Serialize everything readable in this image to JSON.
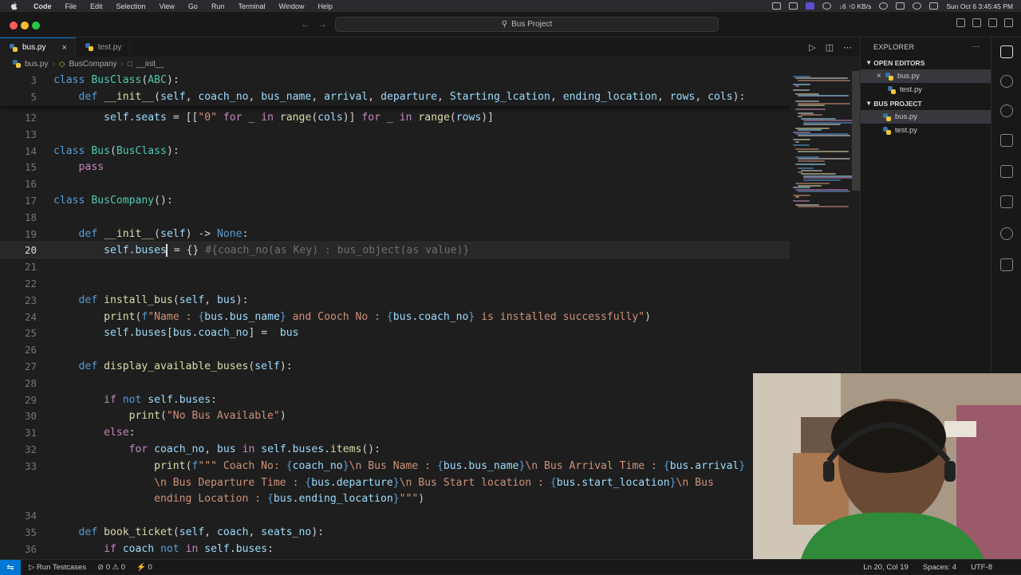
{
  "menubar": {
    "app": "Code",
    "items": [
      "File",
      "Edit",
      "Selection",
      "View",
      "Go",
      "Run",
      "Terminal",
      "Window",
      "Help"
    ],
    "net_speed": "↓6 ↑0 KB/s",
    "datetime": "Sun Oct 6  3:45:45 PM"
  },
  "titlebar": {
    "project": "Bus Project"
  },
  "tabs": [
    {
      "label": "bus.py",
      "active": true
    },
    {
      "label": "test.py",
      "active": false
    }
  ],
  "breadcrumb": {
    "file": "bus.py",
    "cls": "BusCompany",
    "method": "__init__"
  },
  "editor": {
    "cursor_line": "20",
    "lines": [
      {
        "n": "3",
        "html": "<span class=\"k\">class</span> <span class=\"c\">BusClass</span><span class=\"b\">(</span><span class=\"c\">ABC</span><span class=\"b\">):</span>"
      },
      {
        "n": "5",
        "html": "    <span class=\"k\">def</span> <span class=\"f\">__init__</span><span class=\"b\">(</span><span class=\"p\">self</span>, <span class=\"p\">coach_no</span>, <span class=\"p\">bus_name</span>, <span class=\"p\">arrival</span>, <span class=\"p\">departure</span>, <span class=\"p\">Starting_lcation</span>, <span class=\"p\">ending_location</span>, <span class=\"p\">rows</span>, <span class=\"p\">cols</span><span class=\"b\">):</span>"
      },
      {
        "n": "12",
        "html": "        <span class=\"p\">self</span>.<span class=\"v\">seats</span> = [[<span class=\"s\">\"0\"</span> <span class=\"kw\">for</span> <span class=\"v\">_</span> <span class=\"kw\">in</span> <span class=\"f\">range</span>(<span class=\"v\">cols</span>)] <span class=\"kw\">for</span> <span class=\"v\">_</span> <span class=\"kw\">in</span> <span class=\"f\">range</span>(<span class=\"v\">rows</span>)]"
      },
      {
        "n": "13",
        "html": ""
      },
      {
        "n": "14",
        "html": "<span class=\"k\">class</span> <span class=\"c\">Bus</span>(<span class=\"c\">BusClass</span>):"
      },
      {
        "n": "15",
        "html": "    <span class=\"kw\">pass</span>"
      },
      {
        "n": "16",
        "html": ""
      },
      {
        "n": "17",
        "html": "<span class=\"k\">class</span> <span class=\"c\">BusCompany</span>():"
      },
      {
        "n": "18",
        "html": ""
      },
      {
        "n": "19",
        "html": "    <span class=\"k\">def</span> <span class=\"f\">__init__</span>(<span class=\"p\">self</span>) -> <span class=\"k\">None</span>:"
      },
      {
        "n": "20",
        "html": "        <span class=\"p\">self</span>.<span class=\"v\">buses</span><span class=\"cursor\"></span> = {} <span class=\"ghost\">#{coach_no(as Key) : bus_object(as value)}</span>"
      },
      {
        "n": "21",
        "html": ""
      },
      {
        "n": "22",
        "html": ""
      },
      {
        "n": "23",
        "html": "    <span class=\"k\">def</span> <span class=\"f\">install_bus</span>(<span class=\"p\">self</span>, <span class=\"p\">bus</span>):"
      },
      {
        "n": "24",
        "html": "        <span class=\"f\">print</span>(<span class=\"k\">f</span><span class=\"s\">\"Name : </span><span class=\"k\">{</span><span class=\"v\">bus</span>.<span class=\"v\">bus_name</span><span class=\"k\">}</span><span class=\"s\"> and Cooch No : </span><span class=\"k\">{</span><span class=\"v\">bus</span>.<span class=\"v\">coach_no</span><span class=\"k\">}</span><span class=\"s\"> is installed successfully\"</span>)"
      },
      {
        "n": "25",
        "html": "        <span class=\"p\">self</span>.<span class=\"v\">buses</span>[<span class=\"v\">bus</span>.<span class=\"v\">coach_no</span>] =  <span class=\"v\">bus</span>"
      },
      {
        "n": "26",
        "html": ""
      },
      {
        "n": "27",
        "html": "    <span class=\"k\">def</span> <span class=\"f\">display_available_buses</span>(<span class=\"p\">self</span>):"
      },
      {
        "n": "28",
        "html": ""
      },
      {
        "n": "29",
        "html": "        <span class=\"kw\">if</span> <span class=\"k\">not</span> <span class=\"p\">self</span>.<span class=\"v\">buses</span>:"
      },
      {
        "n": "30",
        "html": "            <span class=\"f\">print</span>(<span class=\"s\">\"No Bus Available\"</span>)"
      },
      {
        "n": "31",
        "html": "        <span class=\"kw\">else</span>:"
      },
      {
        "n": "32",
        "html": "            <span class=\"kw\">for</span> <span class=\"v\">coach_no</span>, <span class=\"v\">bus</span> <span class=\"kw\">in</span> <span class=\"p\">self</span>.<span class=\"v\">buses</span>.<span class=\"f\">items</span>():"
      },
      {
        "n": "33",
        "html": "                <span class=\"f\">print</span>(<span class=\"k\">f</span><span class=\"s\">\"\"\" Coach No: </span><span class=\"k\">{</span><span class=\"v\">coach_no</span><span class=\"k\">}</span><span class=\"s\">\\n Bus Name : </span><span class=\"k\">{</span><span class=\"v\">bus</span>.<span class=\"v\">bus_name</span><span class=\"k\">}</span><span class=\"s\">\\n Bus Arrival Time : </span><span class=\"k\">{</span><span class=\"v\">bus</span>.<span class=\"v\">arrival</span><span class=\"k\">}</span>"
      },
      {
        "n": "",
        "html": "                <span class=\"s\">\\n Bus Departure Time : </span><span class=\"k\">{</span><span class=\"v\">bus</span>.<span class=\"v\">departure</span><span class=\"k\">}</span><span class=\"s\">\\n Bus Start location : </span><span class=\"k\">{</span><span class=\"v\">bus</span>.<span class=\"v\">start_location</span><span class=\"k\">}</span><span class=\"s\">\\n Bus</span>"
      },
      {
        "n": "",
        "html": "                <span class=\"s\">ending Location : </span><span class=\"k\">{</span><span class=\"v\">bus</span>.<span class=\"v\">ending_location</span><span class=\"k\">}</span><span class=\"s\">\"\"\"</span>)"
      },
      {
        "n": "34",
        "html": ""
      },
      {
        "n": "35",
        "html": "    <span class=\"k\">def</span> <span class=\"f\">book_ticket</span>(<span class=\"p\">self</span>, <span class=\"p\">coach</span>, <span class=\"p\">seats_no</span>):"
      },
      {
        "n": "36",
        "html": "        <span class=\"kw\">if</span> <span class=\"v\">coach</span> <span class=\"k\">not</span> <span class=\"kw\">in</span> <span class=\"p\">self</span>.<span class=\"v\">buses</span>:"
      }
    ]
  },
  "explorer": {
    "title": "EXPLORER",
    "open_editors_label": "OPEN EDITORS",
    "open_editors": [
      "bus.py",
      "test.py"
    ],
    "project_label": "BUS PROJECT",
    "project_files": [
      "bus.py",
      "test.py"
    ]
  },
  "statusbar": {
    "run_testcases": "Run Testcases",
    "errors": "⊘ 0 ⚠ 0",
    "ports": "⚡ 0",
    "position": "Ln 20, Col 19",
    "spaces": "Spaces: 4",
    "encoding": "UTF-8"
  },
  "colors": {
    "accent": "#0078d4",
    "background": "#1e1e1e"
  }
}
